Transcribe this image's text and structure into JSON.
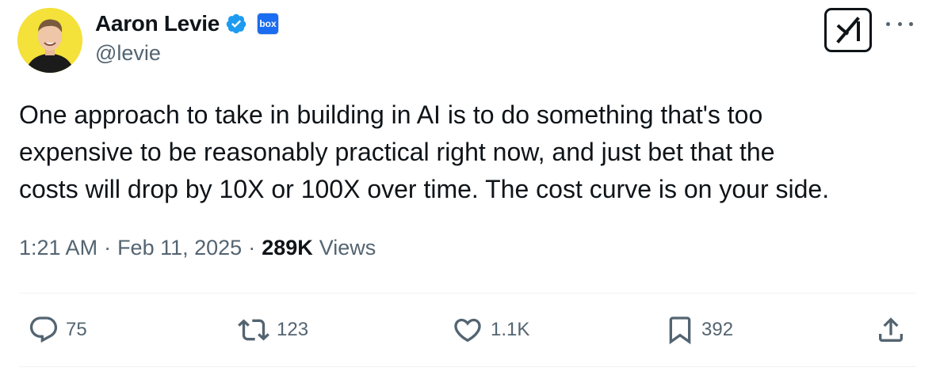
{
  "author": {
    "name": "Aaron Levie",
    "handle": "@levie",
    "affiliation_badge": "box",
    "verified_icon": "verified-badge-icon",
    "avatar_bg": "#f4e13a"
  },
  "tweet": {
    "text": "One approach to take in building in AI is to do something that's too\nexpensive to be reasonably practical right now, and just bet that the\ncosts will drop by 10X or 100X over time. The cost curve is on your side."
  },
  "meta": {
    "time": "1:21 AM",
    "separator": "·",
    "date": "Feb 11, 2025",
    "views_count": "289K",
    "views_label": "Views"
  },
  "actions": {
    "replies": "75",
    "reposts": "123",
    "likes": "1.1K",
    "bookmarks": "392"
  },
  "colors": {
    "text": "#0f1419",
    "secondary": "#536471",
    "verified": "#1d9bf0",
    "box_brand": "#1a6cf0",
    "divider": "#eff3f4"
  }
}
